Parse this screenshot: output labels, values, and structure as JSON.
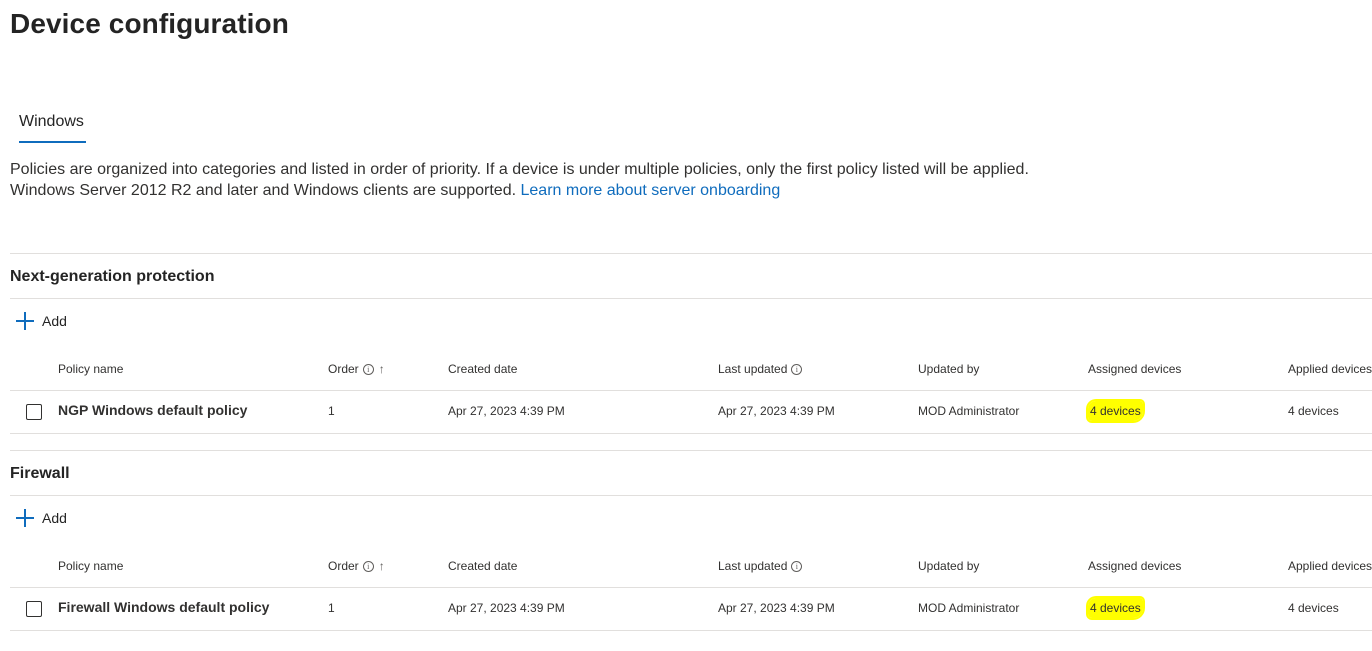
{
  "page": {
    "title": "Device configuration"
  },
  "tabs": [
    {
      "label": "Windows",
      "active": true
    }
  ],
  "description": {
    "line1": "Policies are organized into categories and listed in order of priority. If a device is under multiple policies, only the first policy listed will be applied.",
    "line2": "Windows Server 2012 R2 and later and Windows clients are supported.",
    "link": "Learn more about server onboarding"
  },
  "columns": {
    "policy_name": "Policy name",
    "order": "Order",
    "created_date": "Created date",
    "last_updated": "Last updated",
    "updated_by": "Updated by",
    "assigned_devices": "Assigned devices",
    "applied_devices": "Applied devices"
  },
  "icons": {
    "info": "ⓘ",
    "sort_ascending": "↑",
    "add": "plus-icon"
  },
  "sections": [
    {
      "title": "Next-generation protection",
      "add_label": "Add",
      "rows": [
        {
          "policy_name": "NGP Windows default policy",
          "order": "1",
          "created_date": "Apr 27, 2023 4:39 PM",
          "last_updated": "Apr 27, 2023 4:39 PM",
          "updated_by": "MOD Administrator",
          "assigned_devices": "4 devices",
          "applied_devices": "4 devices"
        }
      ]
    },
    {
      "title": "Firewall",
      "add_label": "Add",
      "rows": [
        {
          "policy_name": "Firewall Windows default policy",
          "order": "1",
          "created_date": "Apr 27, 2023 4:39 PM",
          "last_updated": "Apr 27, 2023 4:39 PM",
          "updated_by": "MOD Administrator",
          "assigned_devices": "4 devices",
          "applied_devices": "4 devices"
        }
      ]
    }
  ],
  "colors": {
    "accent": "#0f6cbd",
    "highlight": "#ffff00",
    "divider": "#e1dfdd"
  }
}
